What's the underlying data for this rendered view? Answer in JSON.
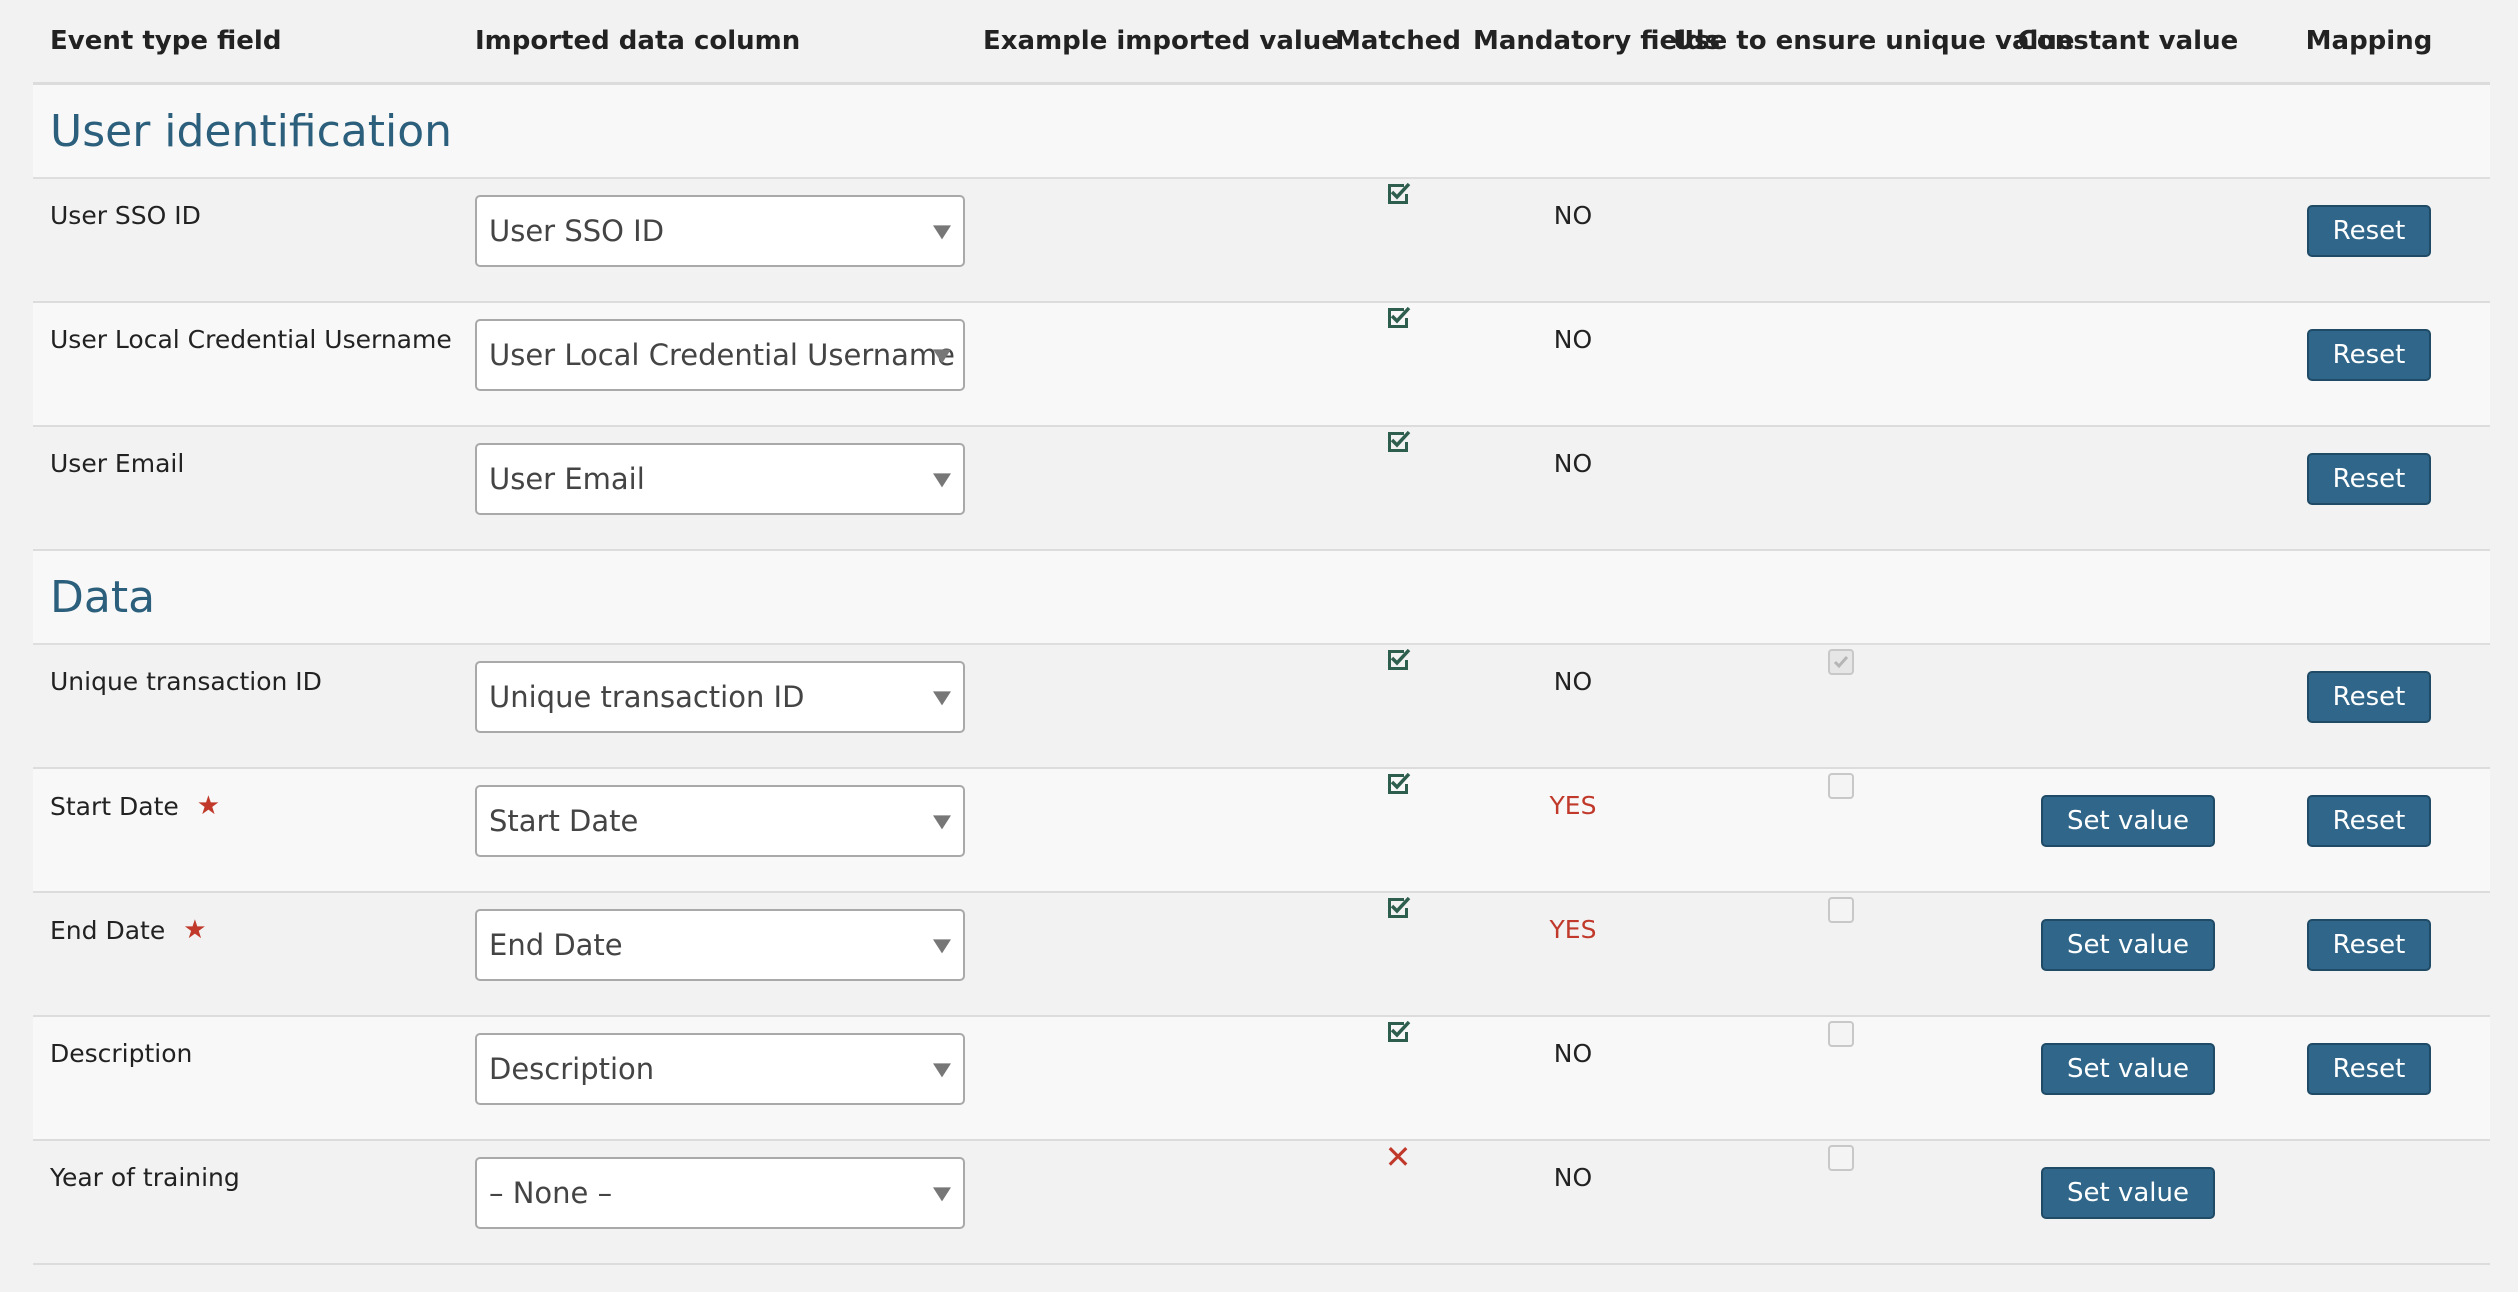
{
  "headers": {
    "event_type_field": "Event type field",
    "imported_data_column": "Imported data column",
    "example_imported_value": "Example imported value",
    "matched": "Matched",
    "mandatory_fields": "Mandatory fields",
    "unique_value": "Use to ensure unique value",
    "constant_value": "Constant value",
    "mapping": "Mapping"
  },
  "sections": {
    "user_identification": "User identification",
    "data": "Data"
  },
  "buttons": {
    "reset": "Reset",
    "set_value": "Set value"
  },
  "rows": [
    {
      "field": "User SSO ID",
      "column": "User SSO ID",
      "matched": true,
      "mandatory": "NO"
    },
    {
      "field": "User Local Credential Username",
      "column": "User Local Credential Username",
      "matched": true,
      "mandatory": "NO"
    },
    {
      "field": "User Email",
      "column": "User Email",
      "matched": true,
      "mandatory": "NO"
    },
    {
      "field": "Unique transaction ID",
      "column": "Unique transaction ID",
      "matched": true,
      "mandatory": "NO"
    },
    {
      "field": "Start Date",
      "column": "Start Date",
      "matched": true,
      "mandatory": "YES"
    },
    {
      "field": "End Date",
      "column": "End Date",
      "matched": true,
      "mandatory": "YES"
    },
    {
      "field": "Description",
      "column": "Description",
      "matched": true,
      "mandatory": "NO"
    },
    {
      "field": "Year of training",
      "column": "– None –",
      "matched": false,
      "mandatory": "NO"
    }
  ],
  "colors": {
    "section_title": "#2b5f7c",
    "button": "#2f6689",
    "matched": "#2e5e4e",
    "required": "#c0392b"
  }
}
